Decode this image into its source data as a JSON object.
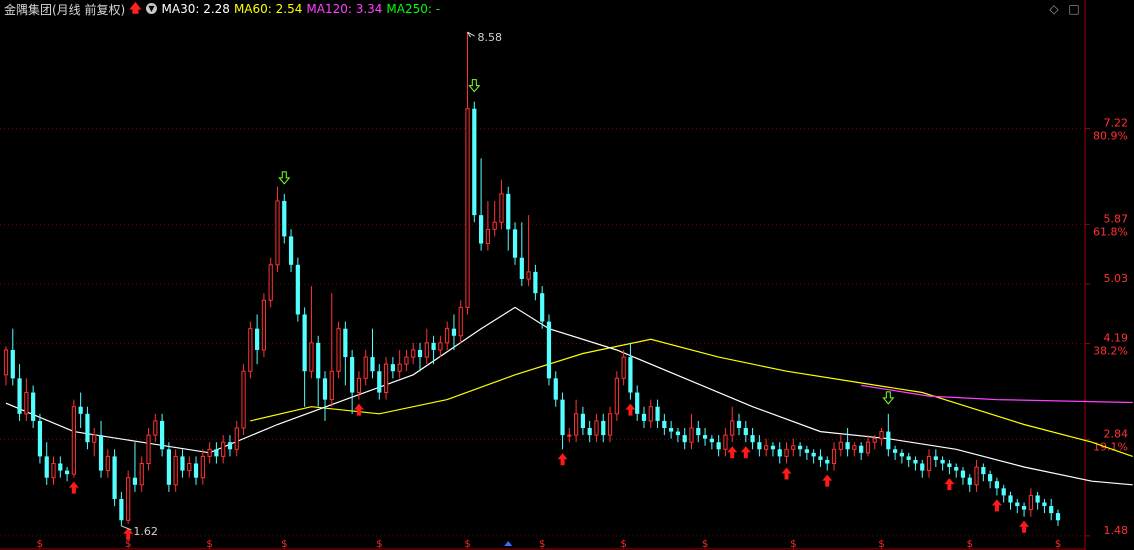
{
  "header": {
    "title": "金隅集团(月线 前复权)",
    "ma30": "MA30: 2.28",
    "ma60": "MA60: 2.54",
    "ma120": "MA120: 3.34",
    "ma250": "MA250: -",
    "colors": {
      "title": "#d7d7d7",
      "ma30": "#ffffff",
      "ma60": "#ffff00",
      "ma120": "#ff40ff",
      "ma250": "#00ff00"
    },
    "icons": [
      "red-up-arrow-icon",
      "ma-dropdown-icon",
      "diamond-icon",
      "square-icon"
    ]
  },
  "chart_data": {
    "type": "candlestick",
    "title": "金隅集团(月线 前复权)",
    "ylim": [
      1.45,
      8.75
    ],
    "price_axis_labels": [
      {
        "value": 7.22,
        "text": "7.22",
        "pct": "80.9%"
      },
      {
        "value": 5.87,
        "text": "5.87",
        "pct": "61.8%"
      },
      {
        "value": 5.03,
        "text": "5.03",
        "pct": ""
      },
      {
        "value": 4.19,
        "text": "4.19",
        "pct": "38.2%"
      },
      {
        "value": 2.84,
        "text": "2.84",
        "pct": "19.1%"
      },
      {
        "value": 1.48,
        "text": "1.48",
        "pct": ""
      }
    ],
    "high_label": "8.58",
    "low_label": "1.62",
    "colors": {
      "up": "#ff3232",
      "down": "#54ffff",
      "grid": "#7a0000",
      "axis": "#a00000",
      "label": "#ff3232",
      "ma30": "#ffffff",
      "ma60": "#ffff00",
      "ma120": "#ff40ff"
    },
    "candles": [
      [
        3.75,
        4.1,
        3.6,
        4.15
      ],
      [
        4.1,
        3.7,
        3.6,
        4.4
      ],
      [
        3.7,
        3.2,
        3.1,
        3.9
      ],
      [
        3.2,
        3.5,
        3.1,
        3.7
      ],
      [
        3.5,
        3.1,
        3.0,
        3.6
      ],
      [
        3.1,
        2.6,
        2.5,
        3.2
      ],
      [
        2.6,
        2.3,
        2.2,
        2.8
      ],
      [
        2.3,
        2.5,
        2.2,
        2.6
      ],
      [
        2.5,
        2.4,
        2.3,
        2.6
      ],
      [
        2.4,
        2.35,
        2.25,
        2.45
      ],
      [
        2.35,
        3.3,
        2.3,
        3.4
      ],
      [
        3.3,
        3.2,
        3.0,
        3.5
      ],
      [
        3.2,
        2.8,
        2.7,
        3.3
      ],
      [
        2.8,
        2.9,
        2.6,
        3.0
      ],
      [
        2.9,
        2.4,
        2.3,
        3.1
      ],
      [
        2.4,
        2.6,
        2.3,
        2.7
      ],
      [
        2.6,
        2.0,
        1.9,
        2.7
      ],
      [
        2.0,
        1.7,
        1.62,
        2.1
      ],
      [
        1.7,
        2.3,
        1.65,
        2.4
      ],
      [
        2.3,
        2.2,
        2.1,
        2.8
      ],
      [
        2.2,
        2.5,
        2.1,
        2.6
      ],
      [
        2.5,
        2.9,
        2.4,
        3.0
      ],
      [
        2.9,
        3.1,
        2.8,
        3.2
      ],
      [
        3.1,
        2.7,
        2.6,
        3.2
      ],
      [
        2.7,
        2.2,
        2.1,
        2.8
      ],
      [
        2.2,
        2.6,
        2.1,
        2.7
      ],
      [
        2.6,
        2.4,
        2.3,
        2.7
      ],
      [
        2.4,
        2.5,
        2.3,
        2.6
      ],
      [
        2.5,
        2.3,
        2.2,
        2.6
      ],
      [
        2.3,
        2.6,
        2.2,
        2.7
      ],
      [
        2.6,
        2.7,
        2.5,
        2.8
      ],
      [
        2.7,
        2.6,
        2.5,
        2.8
      ],
      [
        2.6,
        2.8,
        2.5,
        2.9
      ],
      [
        2.8,
        2.7,
        2.6,
        2.9
      ],
      [
        2.7,
        3.0,
        2.6,
        3.1
      ],
      [
        3.0,
        3.8,
        2.9,
        3.9
      ],
      [
        3.8,
        4.4,
        3.7,
        4.5
      ],
      [
        4.4,
        4.1,
        3.9,
        4.6
      ],
      [
        4.1,
        4.8,
        4.0,
        4.9
      ],
      [
        4.8,
        5.3,
        4.7,
        5.4
      ],
      [
        5.3,
        6.2,
        5.2,
        6.4
      ],
      [
        6.2,
        5.7,
        5.6,
        6.3
      ],
      [
        5.7,
        5.3,
        5.2,
        5.8
      ],
      [
        5.3,
        4.6,
        4.5,
        5.4
      ],
      [
        4.6,
        3.8,
        3.3,
        4.7
      ],
      [
        3.8,
        4.2,
        3.7,
        5.0
      ],
      [
        4.2,
        3.7,
        3.3,
        4.3
      ],
      [
        3.7,
        3.4,
        3.1,
        3.8
      ],
      [
        3.4,
        3.8,
        3.3,
        4.9
      ],
      [
        3.8,
        4.4,
        3.7,
        4.5
      ],
      [
        4.4,
        4.0,
        3.6,
        4.5
      ],
      [
        4.0,
        3.5,
        3.2,
        4.1
      ],
      [
        3.5,
        3.7,
        3.4,
        3.8
      ],
      [
        3.7,
        4.0,
        3.6,
        4.1
      ],
      [
        4.0,
        3.8,
        3.7,
        4.4
      ],
      [
        3.8,
        3.5,
        3.4,
        3.9
      ],
      [
        3.5,
        3.9,
        3.4,
        4.0
      ],
      [
        3.9,
        3.8,
        3.7,
        4.0
      ],
      [
        3.8,
        3.9,
        3.7,
        4.1
      ],
      [
        3.9,
        4.0,
        3.8,
        4.1
      ],
      [
        4.0,
        4.1,
        3.9,
        4.2
      ],
      [
        4.1,
        4.0,
        3.8,
        4.2
      ],
      [
        4.0,
        4.2,
        3.9,
        4.4
      ],
      [
        4.2,
        4.1,
        3.9,
        4.3
      ],
      [
        4.1,
        4.2,
        4.0,
        4.3
      ],
      [
        4.2,
        4.4,
        4.1,
        4.5
      ],
      [
        4.4,
        4.3,
        4.1,
        4.6
      ],
      [
        4.3,
        4.7,
        4.2,
        4.8
      ],
      [
        4.7,
        7.5,
        4.6,
        8.58
      ],
      [
        7.5,
        6.0,
        5.9,
        7.6
      ],
      [
        6.0,
        5.6,
        5.5,
        6.8
      ],
      [
        5.6,
        5.8,
        5.5,
        6.2
      ],
      [
        5.8,
        5.9,
        5.7,
        6.2
      ],
      [
        5.9,
        6.3,
        5.8,
        6.5
      ],
      [
        6.3,
        5.8,
        5.5,
        6.4
      ],
      [
        5.8,
        5.4,
        5.3,
        5.9
      ],
      [
        5.4,
        5.1,
        5.0,
        5.9
      ],
      [
        5.1,
        5.2,
        5.0,
        6.0
      ],
      [
        5.2,
        4.9,
        4.8,
        5.3
      ],
      [
        4.9,
        4.5,
        4.4,
        5.0
      ],
      [
        4.5,
        3.7,
        3.6,
        4.6
      ],
      [
        3.7,
        3.4,
        3.3,
        3.8
      ],
      [
        3.4,
        2.9,
        2.7,
        3.5
      ],
      [
        2.9,
        2.9,
        2.8,
        3.0
      ],
      [
        2.9,
        3.2,
        2.8,
        3.4
      ],
      [
        3.2,
        3.0,
        2.9,
        3.3
      ],
      [
        3.0,
        2.9,
        2.8,
        3.1
      ],
      [
        2.9,
        3.1,
        2.8,
        3.2
      ],
      [
        3.1,
        2.9,
        2.8,
        3.2
      ],
      [
        2.9,
        3.2,
        2.8,
        3.3
      ],
      [
        3.2,
        3.7,
        3.1,
        3.8
      ],
      [
        3.7,
        4.0,
        3.6,
        4.1
      ],
      [
        4.0,
        3.5,
        3.4,
        4.2
      ],
      [
        3.5,
        3.2,
        3.1,
        3.6
      ],
      [
        3.2,
        3.1,
        3.0,
        3.3
      ],
      [
        3.1,
        3.3,
        3.0,
        3.4
      ],
      [
        3.3,
        3.1,
        3.0,
        3.4
      ],
      [
        3.1,
        3.0,
        2.9,
        3.2
      ],
      [
        3.0,
        2.95,
        2.85,
        3.1
      ],
      [
        2.95,
        2.9,
        2.8,
        3.0
      ],
      [
        2.9,
        2.8,
        2.7,
        3.0
      ],
      [
        2.8,
        3.0,
        2.7,
        3.2
      ],
      [
        3.0,
        2.9,
        2.8,
        3.1
      ],
      [
        2.9,
        2.85,
        2.75,
        3.0
      ],
      [
        2.85,
        2.8,
        2.7,
        2.9
      ],
      [
        2.8,
        2.7,
        2.6,
        2.9
      ],
      [
        2.7,
        2.9,
        2.6,
        3.0
      ],
      [
        2.9,
        3.1,
        2.8,
        3.3
      ],
      [
        3.1,
        3.0,
        2.9,
        3.2
      ],
      [
        3.0,
        2.9,
        2.8,
        3.1
      ],
      [
        2.9,
        2.8,
        2.7,
        3.0
      ],
      [
        2.8,
        2.7,
        2.6,
        2.9
      ],
      [
        2.7,
        2.75,
        2.6,
        2.85
      ],
      [
        2.75,
        2.7,
        2.6,
        2.8
      ],
      [
        2.7,
        2.6,
        2.5,
        2.8
      ],
      [
        2.6,
        2.7,
        2.5,
        2.8
      ],
      [
        2.7,
        2.75,
        2.6,
        2.85
      ],
      [
        2.75,
        2.7,
        2.6,
        2.8
      ],
      [
        2.7,
        2.65,
        2.55,
        2.75
      ],
      [
        2.65,
        2.6,
        2.5,
        2.7
      ],
      [
        2.6,
        2.55,
        2.45,
        2.7
      ],
      [
        2.55,
        2.5,
        2.4,
        2.6
      ],
      [
        2.5,
        2.7,
        2.4,
        2.8
      ],
      [
        2.7,
        2.8,
        2.6,
        2.9
      ],
      [
        2.8,
        2.7,
        2.6,
        3.0
      ],
      [
        2.7,
        2.75,
        2.6,
        2.8
      ],
      [
        2.75,
        2.65,
        2.55,
        2.8
      ],
      [
        2.65,
        2.8,
        2.6,
        2.9
      ],
      [
        2.8,
        2.85,
        2.7,
        2.9
      ],
      [
        2.85,
        2.95,
        2.75,
        3.0
      ],
      [
        2.95,
        2.7,
        2.6,
        3.2
      ],
      [
        2.7,
        2.65,
        2.55,
        2.75
      ],
      [
        2.65,
        2.6,
        2.5,
        2.7
      ],
      [
        2.6,
        2.55,
        2.45,
        2.65
      ],
      [
        2.55,
        2.5,
        2.4,
        2.6
      ],
      [
        2.5,
        2.4,
        2.3,
        2.55
      ],
      [
        2.4,
        2.6,
        2.3,
        2.7
      ],
      [
        2.6,
        2.55,
        2.45,
        2.7
      ],
      [
        2.55,
        2.5,
        2.4,
        2.6
      ],
      [
        2.5,
        2.45,
        2.35,
        2.55
      ],
      [
        2.45,
        2.4,
        2.3,
        2.5
      ],
      [
        2.4,
        2.3,
        2.2,
        2.45
      ],
      [
        2.3,
        2.2,
        2.1,
        2.35
      ],
      [
        2.2,
        2.45,
        2.1,
        2.55
      ],
      [
        2.45,
        2.35,
        2.25,
        2.5
      ],
      [
        2.35,
        2.25,
        2.15,
        2.4
      ],
      [
        2.25,
        2.15,
        2.05,
        2.3
      ],
      [
        2.15,
        2.05,
        1.95,
        2.2
      ],
      [
        2.05,
        1.95,
        1.85,
        2.1
      ],
      [
        1.95,
        1.9,
        1.8,
        2.0
      ],
      [
        1.9,
        1.85,
        1.75,
        1.95
      ],
      [
        1.85,
        2.05,
        1.75,
        2.15
      ],
      [
        2.05,
        1.95,
        1.85,
        2.1
      ],
      [
        1.95,
        1.9,
        1.8,
        2.0
      ],
      [
        1.9,
        1.8,
        1.7,
        2.0
      ],
      [
        1.8,
        1.7,
        1.62,
        1.85
      ]
    ],
    "ma30": [
      [
        0,
        3.35
      ],
      [
        10,
        2.95
      ],
      [
        20,
        2.8
      ],
      [
        30,
        2.65
      ],
      [
        40,
        3.05
      ],
      [
        50,
        3.4
      ],
      [
        60,
        3.75
      ],
      [
        70,
        4.4
      ],
      [
        75,
        4.7
      ],
      [
        80,
        4.4
      ],
      [
        90,
        4.1
      ],
      [
        100,
        3.7
      ],
      [
        110,
        3.3
      ],
      [
        120,
        2.95
      ],
      [
        130,
        2.85
      ],
      [
        140,
        2.7
      ],
      [
        150,
        2.45
      ],
      [
        160,
        2.25
      ],
      [
        166,
        2.2
      ]
    ],
    "ma60": [
      [
        36,
        3.1
      ],
      [
        45,
        3.3
      ],
      [
        55,
        3.2
      ],
      [
        65,
        3.4
      ],
      [
        75,
        3.75
      ],
      [
        85,
        4.05
      ],
      [
        95,
        4.25
      ],
      [
        105,
        4.0
      ],
      [
        115,
        3.8
      ],
      [
        125,
        3.65
      ],
      [
        135,
        3.5
      ],
      [
        140,
        3.35
      ],
      [
        150,
        3.05
      ],
      [
        160,
        2.8
      ],
      [
        166,
        2.6
      ]
    ],
    "ma120": [
      [
        126,
        3.6
      ],
      [
        136,
        3.45
      ],
      [
        146,
        3.4
      ],
      [
        166,
        3.36
      ]
    ],
    "up_arrow_markers": [
      10,
      18,
      52,
      82,
      92,
      107,
      109,
      115,
      121,
      139,
      146,
      150
    ],
    "down_arrow_markers": [
      41,
      69,
      130
    ],
    "s_marker_indices": [
      5,
      18,
      30,
      41,
      55,
      68,
      79,
      91,
      103,
      116,
      129,
      142,
      155
    ],
    "triangle_marker_index": 74
  }
}
